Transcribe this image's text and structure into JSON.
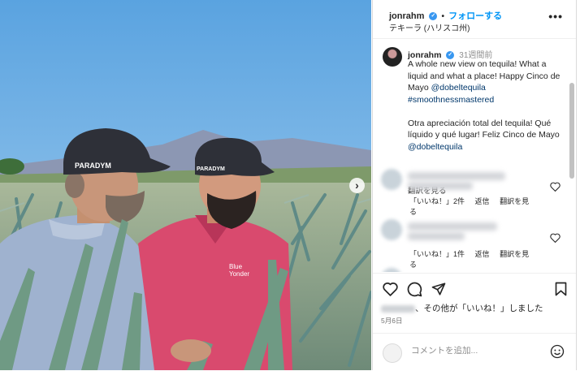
{
  "post": {
    "username": "jonrahm",
    "follow_label": "フォローする",
    "location": "テキーラ (ハリスコ州)",
    "more_label": "•••"
  },
  "photo": {
    "cap_left_brand": "PARADYM",
    "cap_right_brand": "PARADYM",
    "shirt_logo_line1": "Blue",
    "shirt_logo_line2": "Yonder",
    "next_label": "›"
  },
  "caption": {
    "username": "jonrahm",
    "time": "31週間前",
    "text_en_part1": "A whole new view on tequila! What a liquid and what a place! Happy Cinco de Mayo ",
    "mention1": "@dobeltequila",
    "hashtag": "#smoothnessmastered",
    "text_es_part1": "Otra apreciación total del tequila! Qué líquido y qué lugar! Feliz Cinco de Mayo ",
    "mention2": "@dobeltequila",
    "see_translation": "翻訳を見る"
  },
  "comments": [
    {
      "likes": "「いいね！」2件",
      "reply": "返信",
      "translate": "翻訳を見る"
    },
    {
      "likes": "「いいね！」1件",
      "reply": "返信",
      "translate": "翻訳を見る"
    }
  ],
  "likes_text": "、その他が「いいね！」しました",
  "date": "5月6日",
  "add_comment_placeholder": "コメントを追加...",
  "colors": {
    "link": "#0095f6",
    "mention": "#00376b",
    "verified": "#3897f0",
    "accent_shirt": "#d94a6e"
  }
}
